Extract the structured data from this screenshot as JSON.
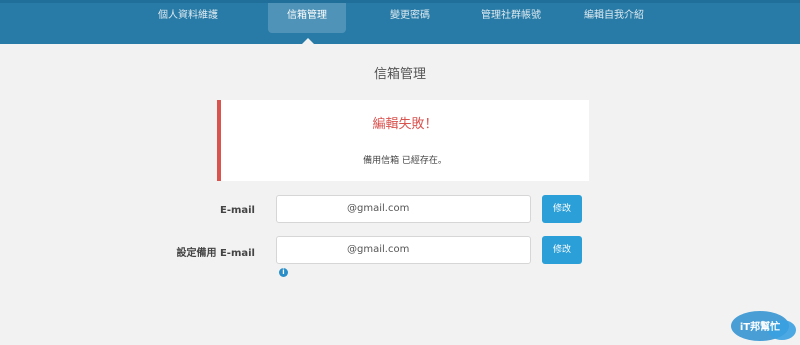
{
  "nav": {
    "tabs": [
      {
        "label": "個人資料維護",
        "active": false
      },
      {
        "label": "信箱管理",
        "active": true
      },
      {
        "label": "變更密碼",
        "active": false
      },
      {
        "label": "管理社群帳號",
        "active": false
      },
      {
        "label": "編輯自我介紹",
        "active": false
      }
    ]
  },
  "page": {
    "title": "信箱管理"
  },
  "alert": {
    "title": "編輯失敗！",
    "message": "備用信箱 已經存在。"
  },
  "form": {
    "email": {
      "label": "E-mail",
      "value": "@gmail.com",
      "button": "修改"
    },
    "backup_email": {
      "label": "設定備用 E-mail",
      "value": "@gmail.com",
      "button": "修改"
    }
  },
  "info_icon": {
    "glyph": "i"
  },
  "watermark": {
    "text": "iT邦幫忙"
  },
  "colors": {
    "nav_bg": "#287ba6",
    "accent": "#2a9fd8",
    "error": "#d9534f"
  }
}
